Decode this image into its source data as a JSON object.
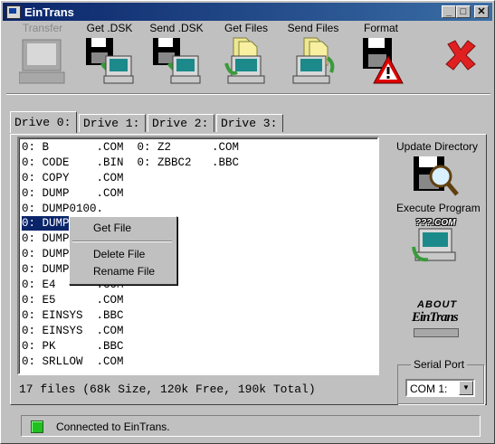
{
  "window": {
    "title": "EinTrans",
    "controls": {
      "minimize": "_",
      "maximize": "□",
      "close": "✕"
    }
  },
  "toolbar": [
    {
      "label": "Transfer",
      "icon": "computer-icon",
      "enabled": false
    },
    {
      "label": "Get .DSK",
      "icon": "floppy-to-computer-icon",
      "enabled": true
    },
    {
      "label": "Send .DSK",
      "icon": "floppy-from-computer-icon",
      "enabled": true
    },
    {
      "label": "Get Files",
      "icon": "get-files-icon",
      "enabled": true
    },
    {
      "label": "Send Files",
      "icon": "send-files-icon",
      "enabled": true
    },
    {
      "label": "Format",
      "icon": "floppy-warning-icon",
      "enabled": true
    },
    {
      "label": "",
      "icon": "exit-x-icon",
      "enabled": true
    }
  ],
  "tabs": [
    "Drive 0:",
    "Drive 1:",
    "Drive 2:",
    "Drive 3:"
  ],
  "active_tab": 0,
  "file_list": {
    "rows": [
      "0: B       .COM  0: Z2      .COM",
      "0: CODE    .BIN  0: ZBBC2   .BBC",
      "0: COPY    .COM",
      "0: DUMP    .COM",
      "0: DUMP0100.",
      "0: DUMP",
      "0: DUMP",
      "0: DUMP",
      "0: DUMP",
      "0: E4      .COM",
      "0: E5      .COM",
      "0: EINSYS  .BBC",
      "0: EINSYS  .COM",
      "0: PK      .BBC",
      "0: SRLLOW  .COM"
    ],
    "selected_index": 5,
    "summary": "17 files (68k Size, 120k Free, 190k Total)"
  },
  "context_menu": {
    "items": [
      "Get File",
      "Delete File",
      "Rename File"
    ]
  },
  "side_panel": {
    "update_directory": "Update Directory",
    "execute_program": "Execute Program",
    "execute_icon_text": "???.COM",
    "about_line1": "ABOUT",
    "about_line2": "EinTrans",
    "serial_port_label": "Serial Port",
    "serial_port_value": "COM 1:"
  },
  "status": {
    "text": "Connected to EinTrans.",
    "indicator_color": "#20c020"
  },
  "colors": {
    "titlebar": "#0a246a",
    "selection": "#0a246a",
    "face": "#c0c0c0"
  }
}
